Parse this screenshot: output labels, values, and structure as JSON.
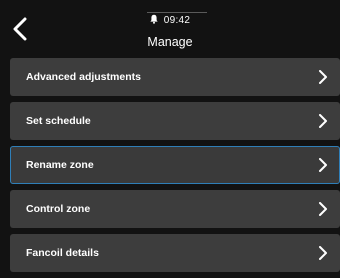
{
  "status": {
    "time": "09:42",
    "bell_icon": "bell-icon"
  },
  "header": {
    "title": "Manage",
    "back_icon": "chevron-left-icon"
  },
  "menu": {
    "items": [
      {
        "label": "Advanced adjustments",
        "selected": false
      },
      {
        "label": "Set schedule",
        "selected": false
      },
      {
        "label": "Rename zone",
        "selected": true
      },
      {
        "label": "Control zone",
        "selected": false
      },
      {
        "label": "Fancoil details",
        "selected": false
      }
    ]
  },
  "colors": {
    "background": "#121212",
    "item_background": "#3d3d3d",
    "selection_border": "#2f7fb8",
    "text": "#ffffff"
  }
}
